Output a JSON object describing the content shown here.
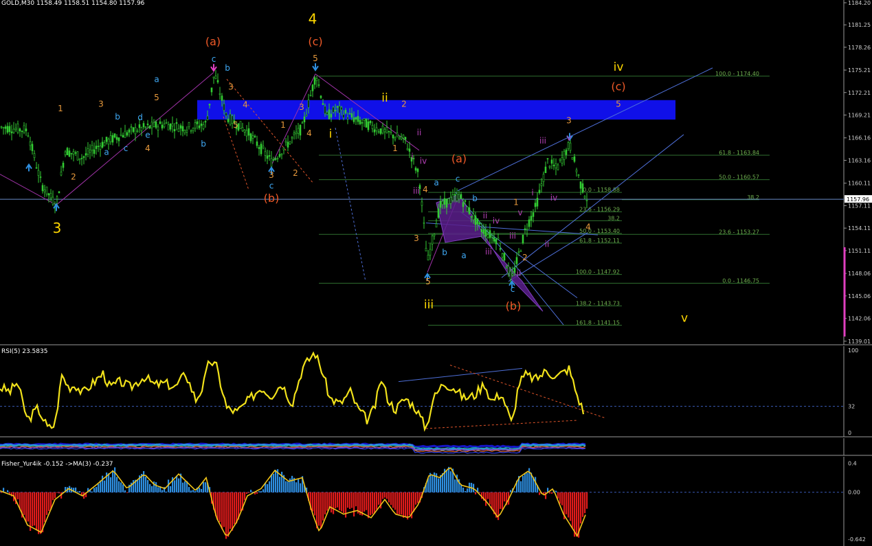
{
  "window": {
    "main_title": "GOLD,M30  1158.49 1158.51 1154.80 1157.96",
    "rsi_title": "RSI(5) 23.5835",
    "fisher_title": "Fisher_Yur4ik -0.152  ->MA(3) -0.237"
  },
  "chart_data": [
    {
      "type": "candlestick",
      "symbol": "GOLD",
      "timeframe": "M30",
      "ohlc_header": {
        "open": 1158.49,
        "high": 1158.51,
        "low": 1154.8,
        "close": 1157.96
      },
      "ylim": [
        1138.9,
        1184.2
      ],
      "y_ticks": [
        "1184.20",
        "1181.25",
        "1178.26",
        "1175.21",
        "1172.21",
        "1169.21",
        "1166.16",
        "1163.16",
        "1160.11",
        "1157.11",
        "1154.11",
        "1151.11",
        "1148.06",
        "1145.06",
        "1142.06",
        "1139.01"
      ],
      "current_price_label": "1157.96",
      "price_path": [
        [
          0,
          1167.6
        ],
        [
          40,
          1167.2
        ],
        [
          60,
          1160
        ],
        [
          82,
          1157.2
        ],
        [
          95,
          1164.5
        ],
        [
          120,
          1163.5
        ],
        [
          145,
          1165.2
        ],
        [
          175,
          1166.5
        ],
        [
          200,
          1167.3
        ],
        [
          240,
          1168
        ],
        [
          270,
          1167.5
        ],
        [
          300,
          1168
        ],
        [
          312,
          1174.8
        ],
        [
          330,
          1169
        ],
        [
          360,
          1167
        ],
        [
          395,
          1163
        ],
        [
          420,
          1165.5
        ],
        [
          440,
          1167.5
        ],
        [
          460,
          1174.7
        ],
        [
          475,
          1169
        ],
        [
          490,
          1170
        ],
        [
          520,
          1168.5
        ],
        [
          560,
          1167
        ],
        [
          590,
          1165.8
        ],
        [
          610,
          1161
        ],
        [
          622,
          1149.5
        ],
        [
          640,
          1157
        ],
        [
          668,
          1158.5
        ],
        [
          700,
          1154
        ],
        [
          725,
          1152.5
        ],
        [
          745,
          1147.2
        ],
        [
          765,
          1154
        ],
        [
          780,
          1157
        ],
        [
          797,
          1163
        ],
        [
          810,
          1162
        ],
        [
          829,
          1165.3
        ],
        [
          845,
          1160
        ],
        [
          855,
          1157.96
        ]
      ],
      "wave_labels": [
        {
          "text": "3",
          "color": "#FFD700",
          "x": 83,
          "y": 1153.5
        },
        {
          "text": "3",
          "color": "#E89A3C",
          "x": 147,
          "y": 1170.3
        },
        {
          "text": "a",
          "color": "#3FA9F5",
          "x": 228,
          "y": 1173.6
        },
        {
          "text": "5",
          "color": "#E89A3C",
          "x": 228,
          "y": 1171.2
        },
        {
          "text": "b",
          "color": "#3FA9F5",
          "x": 171,
          "y": 1168.6
        },
        {
          "text": "d",
          "color": "#3FA9F5",
          "x": 204,
          "y": 1168.5
        },
        {
          "text": "e",
          "color": "#3FA9F5",
          "x": 215,
          "y": 1166.2
        },
        {
          "text": "c",
          "color": "#3FA9F5",
          "x": 183,
          "y": 1164.4
        },
        {
          "text": "4",
          "color": "#E89A3C",
          "x": 215,
          "y": 1164.4
        },
        {
          "text": "a",
          "color": "#3FA9F5",
          "x": 155,
          "y": 1163.9
        },
        {
          "text": "2",
          "color": "#E89A3C",
          "x": 107,
          "y": 1160.6
        },
        {
          "text": "1",
          "color": "#E89A3C",
          "x": 88,
          "y": 1169.7
        },
        {
          "text": "(a)",
          "color": "#F05A28",
          "x": 310,
          "y": 1178.5
        },
        {
          "text": "c",
          "color": "#3FA9F5",
          "x": 311,
          "y": 1176.3
        },
        {
          "text": "b",
          "color": "#3FA9F5",
          "x": 331,
          "y": 1175.1
        },
        {
          "text": "3",
          "color": "#E89A3C",
          "x": 336,
          "y": 1172.6
        },
        {
          "text": "4",
          "color": "#E89A3C",
          "x": 357,
          "y": 1170.2
        },
        {
          "text": "5",
          "color": "#E89A3C",
          "x": 343,
          "y": 1167.5
        },
        {
          "text": "b",
          "color": "#3FA9F5",
          "x": 296,
          "y": 1165.0
        },
        {
          "text": "3",
          "color": "#E89A3C",
          "x": 395,
          "y": 1160.8
        },
        {
          "text": "c",
          "color": "#3FA9F5",
          "x": 395,
          "y": 1159.4
        },
        {
          "text": "(b)",
          "color": "#F05A28",
          "x": 395,
          "y": 1157.6
        },
        {
          "text": "2",
          "color": "#E89A3C",
          "x": 430,
          "y": 1161.1
        },
        {
          "text": "1",
          "color": "#E89A3C",
          "x": 412,
          "y": 1167.5
        },
        {
          "text": "4",
          "color": "#E89A3C",
          "x": 450,
          "y": 1166.4
        },
        {
          "text": "3",
          "color": "#E89A3C",
          "x": 439,
          "y": 1169.9
        },
        {
          "text": "4",
          "color": "#FFD700",
          "x": 455,
          "y": 1181.4
        },
        {
          "text": "(c)",
          "color": "#F05A28",
          "x": 459,
          "y": 1178.5
        },
        {
          "text": "5",
          "color": "#E89A3C",
          "x": 459,
          "y": 1176.4
        },
        {
          "text": "ii",
          "color": "#FFD700",
          "x": 560,
          "y": 1171.0
        },
        {
          "text": "2",
          "color": "#E89A3C",
          "x": 588,
          "y": 1170.3
        },
        {
          "text": "i",
          "color": "#FFD700",
          "x": 481,
          "y": 1166.2
        },
        {
          "text": "1",
          "color": "#E89A3C",
          "x": 575,
          "y": 1164.4
        },
        {
          "text": "ii",
          "color": "#B33FB5",
          "x": 610,
          "y": 1166.5
        },
        {
          "text": "i",
          "color": "#B33FB5",
          "x": 600,
          "y": 1163.3
        },
        {
          "text": "iv",
          "color": "#B33FB5",
          "x": 616,
          "y": 1162.7
        },
        {
          "text": "iii",
          "color": "#B33FB5",
          "x": 606,
          "y": 1158.7
        },
        {
          "text": "4",
          "color": "#E89A3C",
          "x": 619,
          "y": 1158.9
        },
        {
          "text": "a",
          "color": "#3FA9F5",
          "x": 635,
          "y": 1159.8
        },
        {
          "text": "c",
          "color": "#3FA9F5",
          "x": 666,
          "y": 1160.3
        },
        {
          "text": "(a)",
          "color": "#F05A28",
          "x": 668,
          "y": 1162.9
        },
        {
          "text": "b",
          "color": "#3FA9F5",
          "x": 691,
          "y": 1157.7
        },
        {
          "text": "3",
          "color": "#E89A3C",
          "x": 606,
          "y": 1152.4
        },
        {
          "text": "b",
          "color": "#3FA9F5",
          "x": 647,
          "y": 1150.5
        },
        {
          "text": "a",
          "color": "#3FA9F5",
          "x": 675,
          "y": 1150.1
        },
        {
          "text": "iii",
          "color": "#B33FB5",
          "x": 711,
          "y": 1150.6
        },
        {
          "text": "5",
          "color": "#E89A3C",
          "x": 623,
          "y": 1146.6
        },
        {
          "text": "iii",
          "color": "#FFD700",
          "x": 624,
          "y": 1143.4
        },
        {
          "text": "ii",
          "color": "#B33FB5",
          "x": 706,
          "y": 1155.4
        },
        {
          "text": "iv",
          "color": "#B33FB5",
          "x": 722,
          "y": 1154.7
        },
        {
          "text": "v",
          "color": "#B33FB5",
          "x": 757,
          "y": 1155.8
        },
        {
          "text": "iii",
          "color": "#B33FB5",
          "x": 746,
          "y": 1152.7
        },
        {
          "text": "c",
          "color": "#3FA9F5",
          "x": 746,
          "y": 1145.6
        },
        {
          "text": "(b)",
          "color": "#F05A28",
          "x": 747,
          "y": 1143.2
        },
        {
          "text": "ii",
          "color": "#B33FB5",
          "x": 755,
          "y": 1147.7
        },
        {
          "text": "1",
          "color": "#E89A3C",
          "x": 751,
          "y": 1157.2
        },
        {
          "text": "2",
          "color": "#E89A3C",
          "x": 764,
          "y": 1149.8
        },
        {
          "text": "i",
          "color": "#B33FB5",
          "x": 775,
          "y": 1158.5
        },
        {
          "text": "iv",
          "color": "#B33FB5",
          "x": 806,
          "y": 1157.8
        },
        {
          "text": "ii",
          "color": "#B33FB5",
          "x": 796,
          "y": 1151.6
        },
        {
          "text": "iii",
          "color": "#B33FB5",
          "x": 790,
          "y": 1165.4
        },
        {
          "text": "3",
          "color": "#E89A3C",
          "x": 828,
          "y": 1168.1
        },
        {
          "text": "v",
          "color": "#B33FB5",
          "x": 828,
          "y": 1165.8
        },
        {
          "text": "4",
          "color": "#E89A3C",
          "x": 856,
          "y": 1153.9
        },
        {
          "text": "iv",
          "color": "#FFD700",
          "x": 900,
          "y": 1175.1
        },
        {
          "text": "(c)",
          "color": "#F05A28",
          "x": 900,
          "y": 1172.5
        },
        {
          "text": "5",
          "color": "#E89A3C",
          "x": 900,
          "y": 1170.3
        },
        {
          "text": "v",
          "color": "#FFD700",
          "x": 996,
          "y": 1141.6
        }
      ],
      "fibo_levels": [
        {
          "text": "100.0 - 1174.40",
          "y": 1174.4,
          "x1": 464,
          "x2": 1120
        },
        {
          "text": "61.8 - 1163.84",
          "y": 1163.84,
          "x1": 464,
          "x2": 1120
        },
        {
          "text": "50.0 - 1160.57",
          "y": 1160.57,
          "x1": 464,
          "x2": 1120
        },
        {
          "text": "23.6 - 1153.27",
          "y": 1153.27,
          "x1": 464,
          "x2": 1120
        },
        {
          "text": "0.0 - 1146.75",
          "y": 1146.75,
          "x1": 464,
          "x2": 1120
        },
        {
          "text": "0.0 - 1158.88",
          "y": 1158.88,
          "x1": 623,
          "x2": 905
        },
        {
          "text": "23.6 - 1156.29",
          "y": 1156.29,
          "x1": 623,
          "x2": 905
        },
        {
          "text": "38.2",
          "y": 1155.1,
          "x1": 623,
          "x2": 905
        },
        {
          "text": "50.0 - 1153.40",
          "y": 1153.4,
          "x1": 623,
          "x2": 905
        },
        {
          "text": "61.8 - 1152.11",
          "y": 1152.11,
          "x1": 623,
          "x2": 905
        },
        {
          "text": "100.0 - 1147.92",
          "y": 1147.92,
          "x1": 623,
          "x2": 905
        },
        {
          "text": "138.2 - 1143.73",
          "y": 1143.73,
          "x1": 623,
          "x2": 905
        },
        {
          "text": "161.8 - 1141.15",
          "y": 1141.15,
          "x1": 623,
          "x2": 905
        },
        {
          "text": "38.2",
          "y": 1157.9,
          "x1": 905,
          "x2": 1105
        }
      ]
    },
    {
      "type": "line",
      "name": "RSI(5)",
      "value": 23.5835,
      "ylim": [
        0,
        100
      ],
      "y_ticks": [
        "100",
        "32",
        "0"
      ],
      "level": 32,
      "values": [
        [
          0,
          55
        ],
        [
          15,
          50
        ],
        [
          25,
          62
        ],
        [
          40,
          15
        ],
        [
          55,
          30
        ],
        [
          70,
          5
        ],
        [
          80,
          10
        ],
        [
          90,
          70
        ],
        [
          100,
          55
        ],
        [
          110,
          58
        ],
        [
          120,
          48
        ],
        [
          135,
          60
        ],
        [
          150,
          72
        ],
        [
          160,
          55
        ],
        [
          175,
          62
        ],
        [
          190,
          55
        ],
        [
          210,
          68
        ],
        [
          225,
          58
        ],
        [
          240,
          60
        ],
        [
          255,
          55
        ],
        [
          270,
          72
        ],
        [
          285,
          40
        ],
        [
          295,
          55
        ],
        [
          305,
          88
        ],
        [
          315,
          80
        ],
        [
          330,
          30
        ],
        [
          345,
          25
        ],
        [
          360,
          38
        ],
        [
          380,
          55
        ],
        [
          395,
          45
        ],
        [
          410,
          60
        ],
        [
          425,
          35
        ],
        [
          440,
          78
        ],
        [
          458,
          98
        ],
        [
          470,
          72
        ],
        [
          480,
          42
        ],
        [
          495,
          35
        ],
        [
          510,
          50
        ],
        [
          520,
          30
        ],
        [
          535,
          15
        ],
        [
          545,
          30
        ],
        [
          555,
          65
        ],
        [
          565,
          40
        ],
        [
          575,
          28
        ],
        [
          590,
          42
        ],
        [
          605,
          30
        ],
        [
          620,
          5
        ],
        [
          630,
          40
        ],
        [
          645,
          60
        ],
        [
          660,
          55
        ],
        [
          675,
          42
        ],
        [
          690,
          45
        ],
        [
          705,
          60
        ],
        [
          715,
          38
        ],
        [
          730,
          48
        ],
        [
          745,
          10
        ],
        [
          755,
          60
        ],
        [
          765,
          70
        ],
        [
          780,
          65
        ],
        [
          795,
          75
        ],
        [
          810,
          68
        ],
        [
          828,
          78
        ],
        [
          840,
          45
        ],
        [
          850,
          23.6
        ]
      ]
    },
    {
      "type": "line",
      "name": "middle indicator",
      "values": []
    },
    {
      "type": "bar",
      "name": "Fisher_Yur4ik",
      "value": -0.152,
      "ma_label": "->MA(3)",
      "ma_value": -0.237,
      "ylim": [
        -0.7,
        0.45
      ],
      "y_ticks": [
        "0.4",
        "0.00",
        "-0.642"
      ],
      "pos_color": "#2E8FE0",
      "neg_color": "#E01B1B",
      "ma_color": "#F0C419"
    }
  ]
}
